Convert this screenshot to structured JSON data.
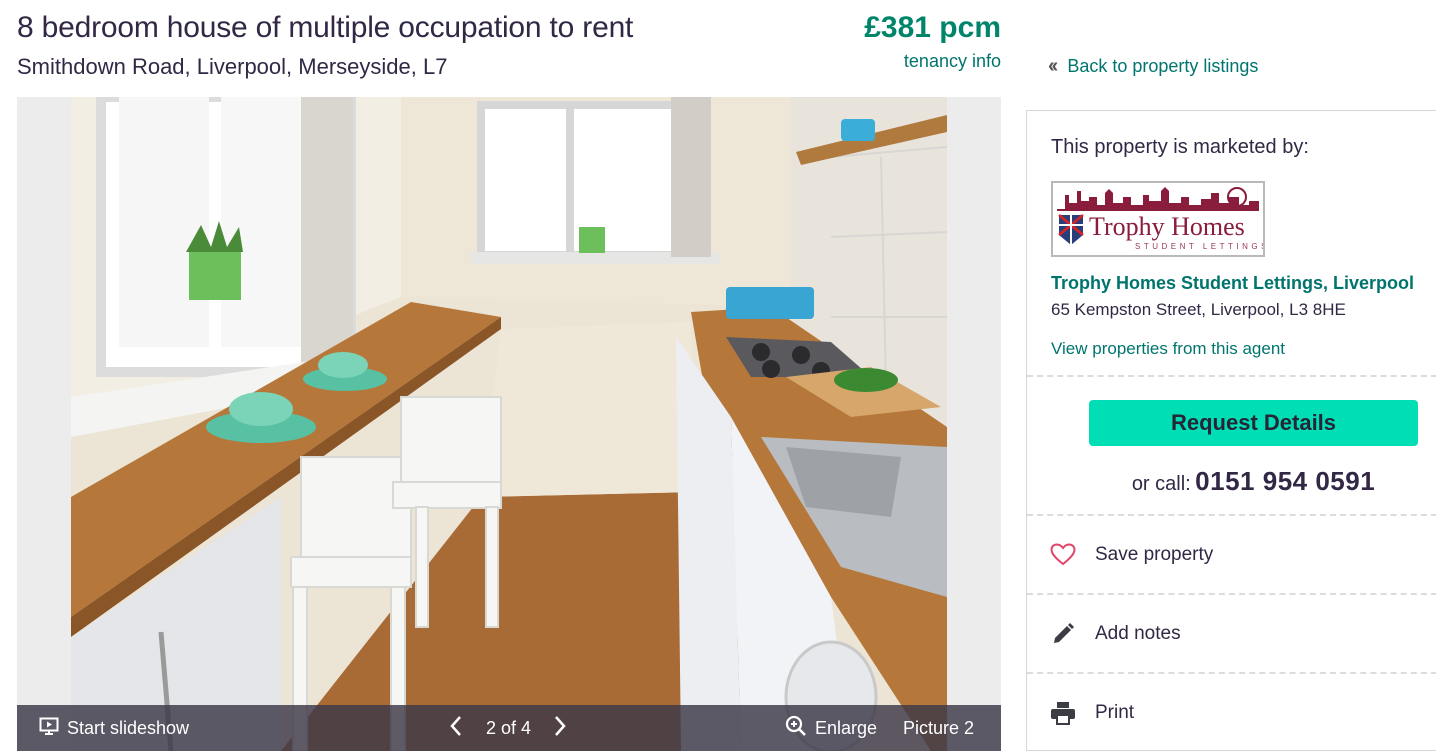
{
  "listing": {
    "title": "8 bedroom house of multiple occupation to rent",
    "address": "Smithdown Road, Liverpool, Merseyside, L7",
    "price": "£381 pcm",
    "tenancy_link": "tenancy info"
  },
  "gallery": {
    "slideshow_label": "Start slideshow",
    "counter": "2 of 4",
    "enlarge_label": "Enlarge",
    "picture_label": "Picture 2",
    "icons": [
      "slideshow-icon",
      "chevron-left-icon",
      "chevron-right-icon",
      "zoom-icon"
    ]
  },
  "sidebar": {
    "back_link": "Back to property listings",
    "marketed_by": "This property is marketed by:",
    "agent": {
      "logo_text": "Trophy Homes",
      "logo_subtext": "STUDENT LETTINGS",
      "name": "Trophy Homes Student Lettings, Liverpool",
      "address": "65 Kempston Street, Liverpool, L3 8HE",
      "view_link": "View properties from this agent"
    },
    "request_button": "Request Details",
    "call_prefix": "or call:",
    "phone": "0151 954 0591",
    "actions": [
      {
        "label": "Save property",
        "icon": "heart-icon"
      },
      {
        "label": "Add notes",
        "icon": "pencil-icon"
      },
      {
        "label": "Print",
        "icon": "printer-icon"
      }
    ]
  },
  "colors": {
    "accent_green": "#00856a",
    "link_teal": "#00756e",
    "cta": "#00deb6",
    "heart": "#e0456a",
    "logo_maroon": "#8a1c3c"
  }
}
